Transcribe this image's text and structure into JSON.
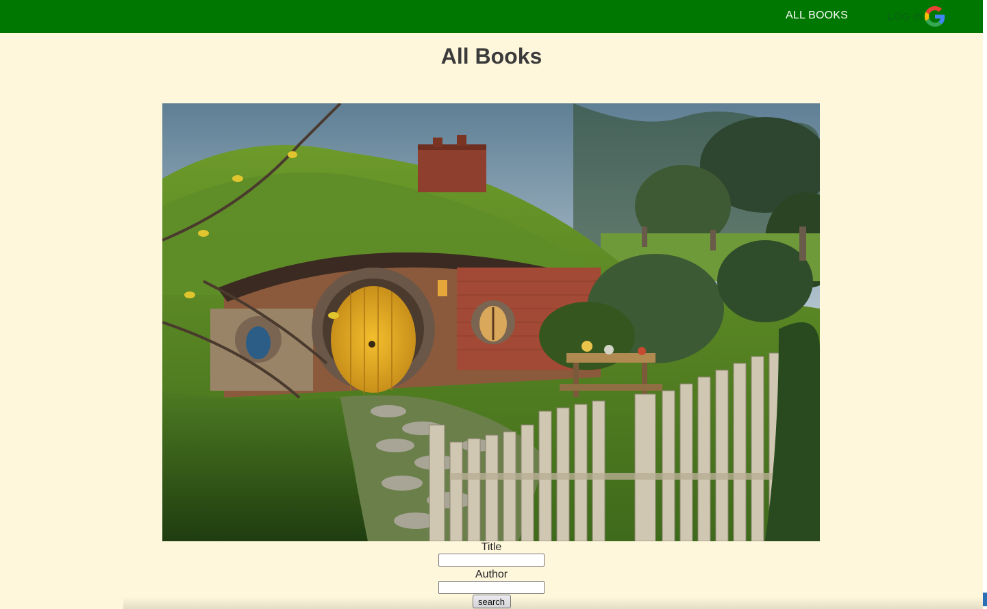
{
  "navbar": {
    "all_books_label": "ALL BOOKS",
    "login_label": "LOG IN",
    "login_icon": "google-icon",
    "background": "#007700"
  },
  "page": {
    "title": "All Books",
    "background": "#fef7dc"
  },
  "hero": {
    "image_alt": "hero-image"
  },
  "search_form": {
    "title_label": "Title",
    "title_value": "",
    "author_label": "Author",
    "author_value": "",
    "search_button_label": "search"
  }
}
